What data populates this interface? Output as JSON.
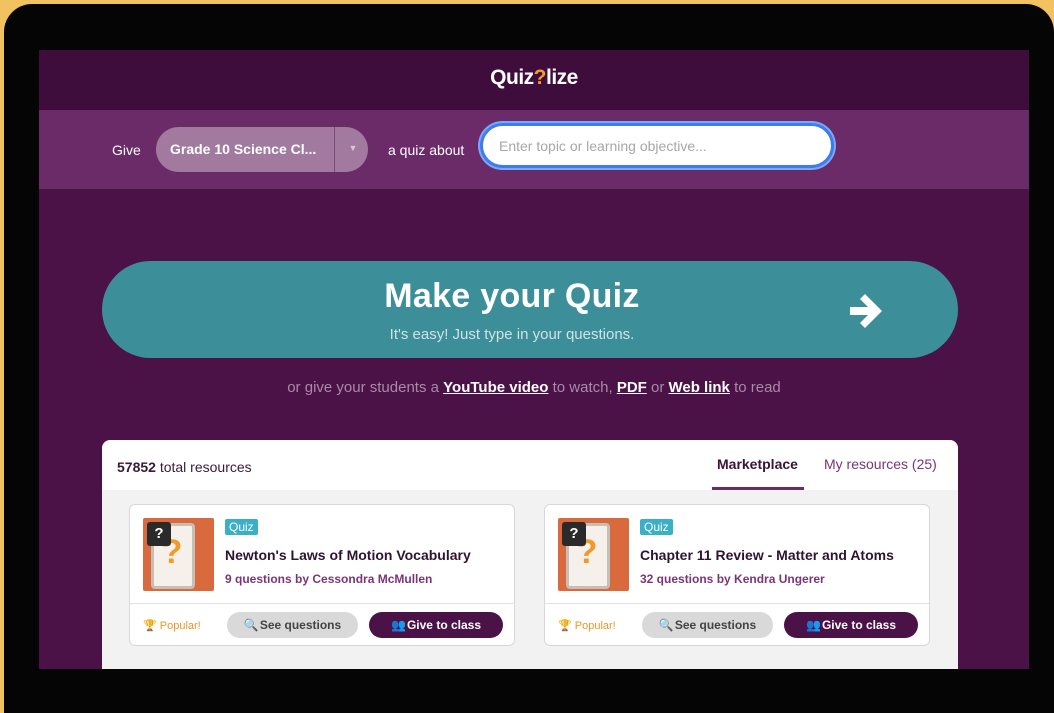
{
  "app": {
    "logo_text_1": "Quiz",
    "logo_text_2": "?",
    "logo_text_3": "lize"
  },
  "givebar": {
    "give_label": "Give",
    "class_selected": "Grade 10 Science Cl...",
    "quiz_about": "a quiz about",
    "topic_placeholder": "Enter topic or learning objective..."
  },
  "make_quiz": {
    "title": "Make your Quiz",
    "subtitle": "It's easy! Just type in your questions."
  },
  "alt_sources": {
    "prefix": "or give your students a",
    "youtube": "YouTube video",
    "mid1": "to watch,",
    "pdf": "PDF",
    "mid2": "or",
    "weblink": "Web link",
    "suffix": "to read"
  },
  "resources": {
    "total_count": "57852",
    "total_label": "total resources",
    "tabs": [
      {
        "label": "Marketplace",
        "active": true
      },
      {
        "label": "My resources (25)",
        "active": false
      }
    ],
    "cards": [
      {
        "tag": "Quiz",
        "title": "Newton's Laws of Motion Vocabulary",
        "meta": "9 questions by Cessondra McMullen",
        "popular": "Popular!",
        "see_label": "See questions",
        "give_label": "Give to class"
      },
      {
        "tag": "Quiz",
        "title": "Chapter 11 Review - Matter and Atoms",
        "meta": "32 questions by Kendra Ungerer",
        "popular": "Popular!",
        "see_label": "See questions",
        "give_label": "Give to class"
      }
    ]
  },
  "colors": {
    "background": "#4b1247",
    "accent_teal": "#3c8e98",
    "purple_button": "#4b1247",
    "popular_orange": "#e9972a",
    "quiz_tag": "#3ab0c8"
  }
}
